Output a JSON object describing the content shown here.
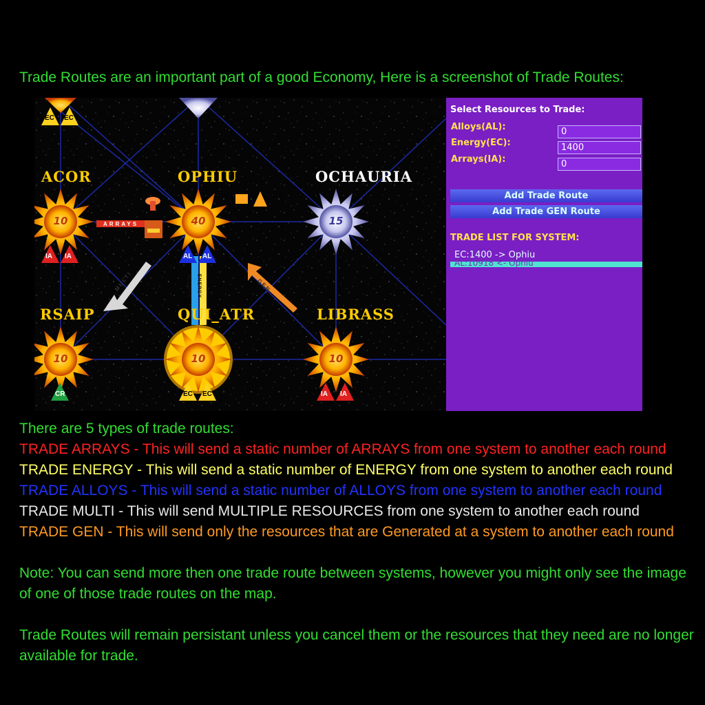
{
  "intro": "Trade Routes are an important part of a good Economy, Here is a screenshot of Trade Routes:",
  "map": {
    "systems": [
      {
        "name": "ACOR",
        "value": "10",
        "tags": [
          "IA",
          "IA"
        ]
      },
      {
        "name": "OPHIU",
        "value": "40",
        "tags": [
          "AL",
          "AL"
        ]
      },
      {
        "name": "OCHAURIA",
        "value": "15",
        "tags": []
      },
      {
        "name": "RSAIP",
        "value": "10",
        "tags": [
          "CR"
        ]
      },
      {
        "name": "QUI_ATR",
        "value": "10",
        "tags": [
          "EC",
          "EC"
        ]
      },
      {
        "name": "LIBRASS",
        "value": "10",
        "tags": [
          "IA",
          "IA"
        ]
      }
    ],
    "top_tags": [
      "EC",
      "EC"
    ],
    "route_labels": {
      "arrays": "ARRAYS",
      "multi": "MULTI",
      "gen": "GEN",
      "energy": "ENERGY",
      "alloys": "ALLOYS"
    }
  },
  "panel": {
    "title": "Select Resources to Trade:",
    "fields": [
      {
        "label": "Alloys(AL):",
        "value": "0"
      },
      {
        "label": "Energy(EC):",
        "value": "1400"
      },
      {
        "label": "Arrays(IA):",
        "value": "0"
      }
    ],
    "add_route": "Add Trade Route",
    "add_gen_route": "Add Trade GEN Route",
    "trade_list_title": "TRADE LIST FOR SYSTEM:",
    "trade_items": [
      "EC:1400 -> Ophiu",
      "AL:10918 <- Ophiu"
    ]
  },
  "types_heading": "There are 5 types of trade routes:",
  "types": [
    {
      "text": "TRADE ARRAYS - This will send a static number of ARRAYS from one system to another each round",
      "color": "#ff2222"
    },
    {
      "text": "TRADE ENERGY - This will send a static number of ENERGY from one system to another each round",
      "color": "#ffff66"
    },
    {
      "text": "TRADE ALLOYS - This will send a static number of ALLOYS from one system to another each round",
      "color": "#2233ff"
    },
    {
      "text": "TRADE MULTI - This will send MULTIPLE RESOURCES from one system to another each round",
      "color": "#e8e8e8"
    },
    {
      "text": "TRADE GEN - This will send only the resources that are Generated at a system to another each round",
      "color": "#ff9922"
    }
  ],
  "note_line1": "Note: You can send more then one trade route between systems, however you might only see the image",
  "note_line2": "of one of those trade routes on the map.",
  "persist_line1": "Trade Routes will remain persistant unless you cancel them or the resources that they need are no longer",
  "persist_line2": "available for trade."
}
